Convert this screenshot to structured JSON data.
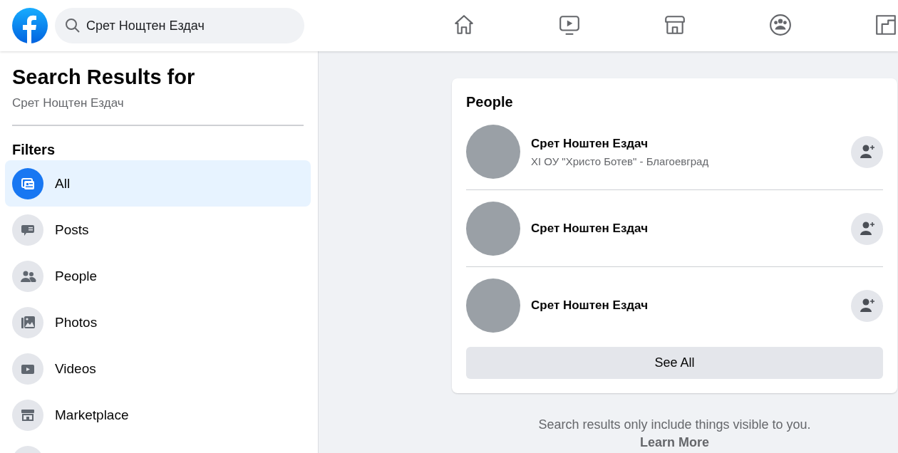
{
  "search": {
    "value": "Срет Нощтен Ездач"
  },
  "nav": [
    {
      "kind": "home",
      "selected": false
    },
    {
      "kind": "video",
      "selected": false
    },
    {
      "kind": "store",
      "selected": false
    },
    {
      "kind": "groups",
      "selected": false
    },
    {
      "kind": "gaming",
      "selected": false
    }
  ],
  "sidebar": {
    "title": "Search Results for",
    "query": "Срет Нощтен Ездач",
    "filters_title": "Filters",
    "items": [
      {
        "kind": "all",
        "label": "All",
        "selected": true
      },
      {
        "kind": "posts",
        "label": "Posts",
        "selected": false
      },
      {
        "kind": "people",
        "label": "People",
        "selected": false
      },
      {
        "kind": "photos",
        "label": "Photos",
        "selected": false
      },
      {
        "kind": "videos",
        "label": "Videos",
        "selected": false
      },
      {
        "kind": "marketplace",
        "label": "Marketplace",
        "selected": false
      },
      {
        "kind": "blank",
        "selected": false
      }
    ]
  },
  "people_card": {
    "title": "People",
    "people": [
      {
        "name": "Срет Ноштен Ездач",
        "subtitle": "XI ОУ \"Христо Ботев\" - Благоевград"
      },
      {
        "name": "Срет Ноштен Ездач"
      },
      {
        "name": "Срет Ноштен Ездач"
      }
    ],
    "see_all": "See All"
  },
  "footer": {
    "note": "Search results only include things visible to you.",
    "link": "Learn More"
  }
}
